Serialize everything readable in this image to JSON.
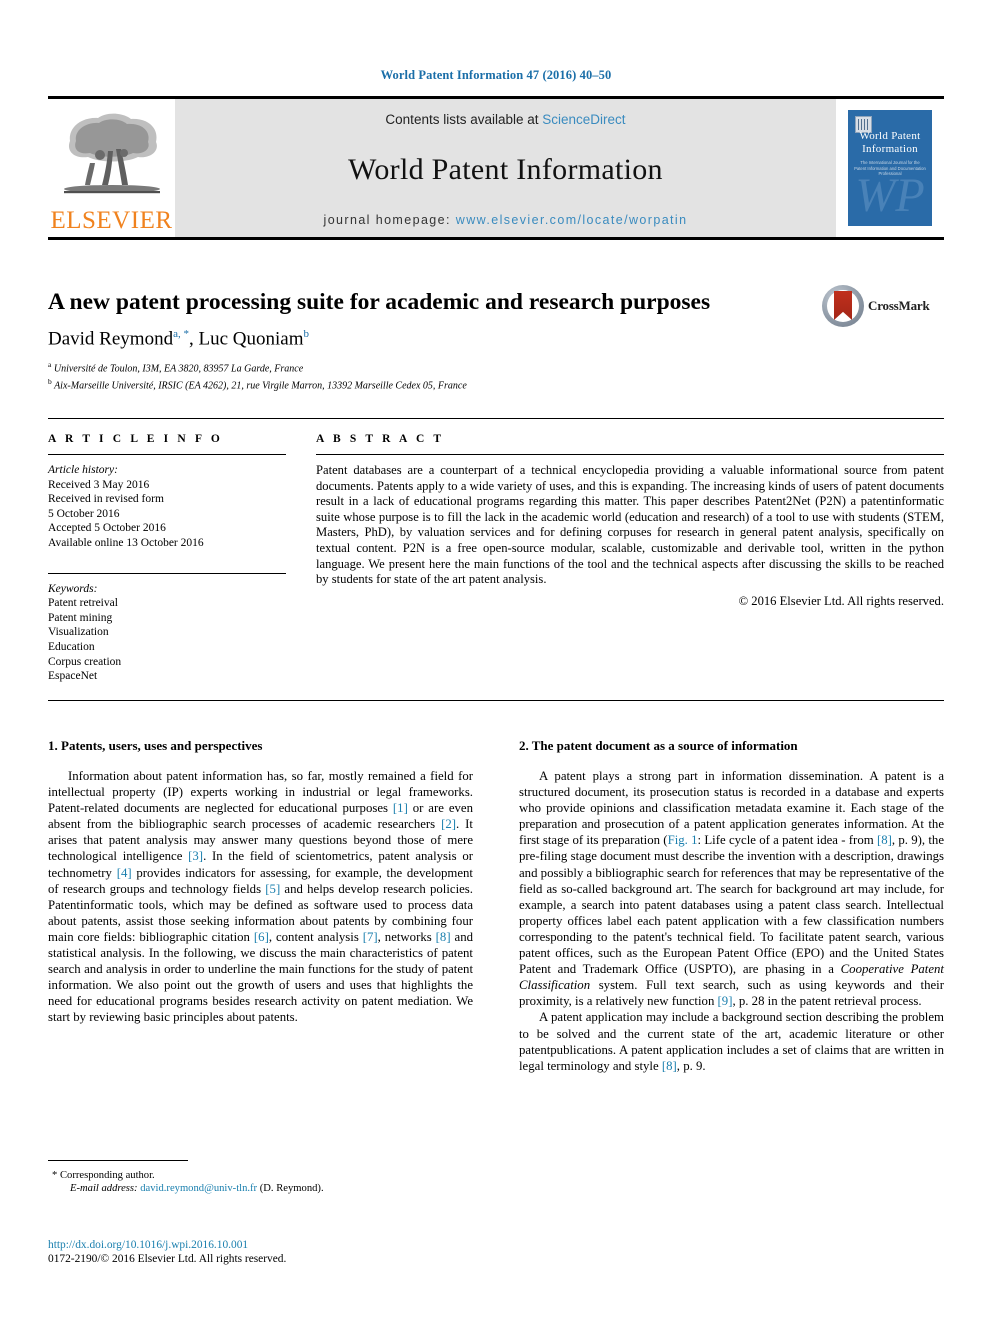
{
  "running_head": "World Patent Information 47 (2016) 40–50",
  "masthead": {
    "contents_prefix": "Contents lists available at",
    "sciencedirect": "ScienceDirect",
    "journal_title": "World Patent Information",
    "homepage_prefix": "journal homepage:",
    "homepage_url": "www.elsevier.com/locate/worpatin",
    "publisher_logo_text": "ELSEVIER",
    "publisher_logo_color": "#F0821E",
    "link_color": "#3a8bbf",
    "cover": {
      "title_line1": "World Patent",
      "title_line2": "Information",
      "subtitle": "The International Journal for the Patent Information and Documentation Professional",
      "monogram": "WP",
      "background_color": "#2a6ba8"
    }
  },
  "article": {
    "title": "A new patent processing suite for academic and research purposes",
    "authors": "David Reymond",
    "author_1": "David Reymond",
    "author_1_marks": "a, *",
    "author_2": ", Luc Quoniam",
    "author_2_marks": "b",
    "affiliation_a_mark": "a",
    "affiliation_a": "Université de Toulon, I3M, EA 3820, 83957 La Garde, France",
    "affiliation_b_mark": "b",
    "affiliation_b": "Aix-Marseille Université, IRSIC (EA 4262), 21, rue Virgile Marron, 13392 Marseille Cedex 05, France",
    "crossmark_label": "CrossMark"
  },
  "article_info": {
    "heading": "A R T I C L E   I N F O",
    "history_label": "Article history:",
    "history": [
      "Received 3 May 2016",
      "Received in revised form",
      "5 October 2016",
      "Accepted 5 October 2016",
      "Available online 13 October 2016"
    ],
    "keywords_label": "Keywords:",
    "keywords": [
      "Patent retreival",
      "Patent mining",
      "Visualization",
      "Education",
      "Corpus creation",
      "EspaceNet"
    ]
  },
  "abstract": {
    "heading": "A B S T R A C T",
    "text": "Patent databases are a counterpart of a technical encyclopedia providing a valuable informational source from patent documents. Patents apply to a wide variety of uses, and this is expanding. The increasing kinds of users of patent documents result in a lack of educational programs regarding this matter. This paper describes Patent2Net (P2N) a patentinformatic suite whose purpose is to fill the lack in the academic world (education and research) of a tool to use with students (STEM, Masters, PhD), by valuation services and for defining corpuses for research in general patent analysis, specifically on textual content. P2N is a free open-source modular, scalable, customizable and derivable tool, written in the python language. We present here the main functions of the tool and the technical aspects after discussing the skills to be reached by students for state of the art patent analysis.",
    "copyright": "© 2016 Elsevier Ltd. All rights reserved."
  },
  "sections": {
    "left_heading": "1. Patents, users, uses and perspectives",
    "right_heading": "2. The patent document as a source of information"
  },
  "body": {
    "left_paragraph_parts": {
      "t1": "Information about patent information has, so far, mostly remained a field for intellectual property (IP) experts working in industrial or legal frameworks. Patent-related documents are neglected for educational purposes ",
      "r1": "[1]",
      "t2": " or are even absent from the bibliographic search processes of academic researchers ",
      "r2": "[2]",
      "t3": ". It arises that patent analysis may answer many questions beyond those of mere technological intelligence ",
      "r3": "[3]",
      "t4": ". In the field of scientometrics, patent analysis or technometry ",
      "r4": "[4]",
      "t5": " provides indicators for assessing, for example, the development of research groups and technology fields ",
      "r5": "[5]",
      "t6": " and helps develop research policies. Patentinformatic tools, which may be defined as software used to process data about patents, assist those seeking information about patents by combining four main core fields: bibliographic citation ",
      "r6": "[6]",
      "t7": ", content analysis ",
      "r7": "[7]",
      "t8": ", networks ",
      "r8": "[8]",
      "t9": " and statistical analysis. In the following, we discuss the main characteristics of patent search and analysis in order to underline the main functions for the study of patent information. We also point out the growth of users and uses that highlights the need for educational programs besides research activity on patent mediation. We start by reviewing basic principles about patents."
    },
    "right_paragraph_1_parts": {
      "t1": "A patent plays a strong part in information dissemination. A patent is a structured document, its prosecution status is recorded in a database and experts who provide opinions and classification metadata examine it. Each stage of the preparation and prosecution of a patent application generates information. At the first stage of its preparation (",
      "r1": "Fig. 1",
      "t2": ": Life cycle of a patent idea - from ",
      "r2": "[8]",
      "t3": ", p. 9), the pre-filing stage document must describe the invention with a description, drawings and possibly a bibliographic search for references that may be representative of the field as so-called background art. The search for background art may include, for example, a search into patent databases using a patent class search. Intellectual property offices label each patent application with a few classification numbers corresponding to the patent's technical field. To facilitate patent search, various patent offices, such as the European Patent Office (EPO) and the United States Patent and Trademark Office (USPTO), are phasing in a ",
      "i1": "Cooperative Patent Classification",
      "t4": " system. Full text search, such as using keywords and their proximity, is a relatively new function ",
      "r3": "[9]",
      "t5": ", p. 28 in the patent retrieval process."
    },
    "right_paragraph_2_parts": {
      "t1": "A patent application may include a background section describing the problem to be solved and the current state of the art, academic literature or other patentpublications. A patent application includes a set of claims that are written in legal terminology and style ",
      "r1": "[8]",
      "t2": ", p. 9."
    }
  },
  "footer": {
    "corresponding_mark": "*",
    "corresponding_text": "Corresponding author.",
    "email_label": "E-mail address:",
    "email": "david.reymond@univ-tln.fr",
    "email_suffix": "(D. Reymond).",
    "doi": "http://dx.doi.org/10.1016/j.wpi.2016.10.001",
    "issn_line": "0172-2190/© 2016 Elsevier Ltd. All rights reserved.",
    "link_color": "#1a7fae"
  }
}
